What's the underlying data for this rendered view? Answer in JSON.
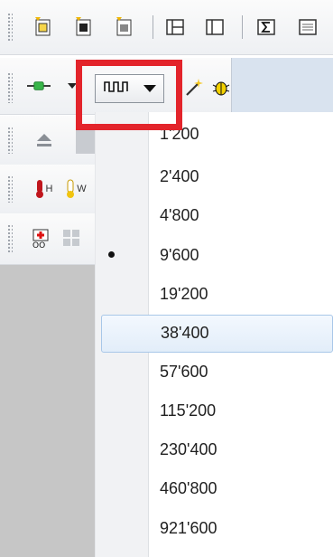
{
  "toolbar": {
    "row1_icons": [
      "open-file-icon",
      "save-file-icon",
      "new-file-icon",
      "layout-icon",
      "panel-icon",
      "sum-icon",
      "list-icon"
    ],
    "baud_button_icon": "square-wave-icon",
    "dropdown_arrow_icon": "triangle-down-icon",
    "extra_icons": [
      "magic-wand-icon",
      "bug-icon"
    ],
    "side_icons": [
      "eject-icon",
      "thermometer-h-icon",
      "thermometer-w-icon",
      "medical-kit-icon",
      "grid-icon"
    ],
    "thermo_h_label": "H",
    "thermo_w_label": "W"
  },
  "baud_menu": {
    "items": [
      {
        "label": "1'200"
      },
      {
        "label": "2'400"
      },
      {
        "label": "4'800"
      },
      {
        "label": "9'600"
      },
      {
        "label": "19'200"
      },
      {
        "label": "38'400"
      },
      {
        "label": "57'600"
      },
      {
        "label": "115'200"
      },
      {
        "label": "230'400"
      },
      {
        "label": "460'800"
      },
      {
        "label": "921'600"
      }
    ],
    "selected": "9'600",
    "hovered": "38'400"
  },
  "colors": {
    "highlight_border": "#e3242b",
    "hover_fill": "#e2edf9",
    "toolbar_blue": "#d9e3ef"
  }
}
